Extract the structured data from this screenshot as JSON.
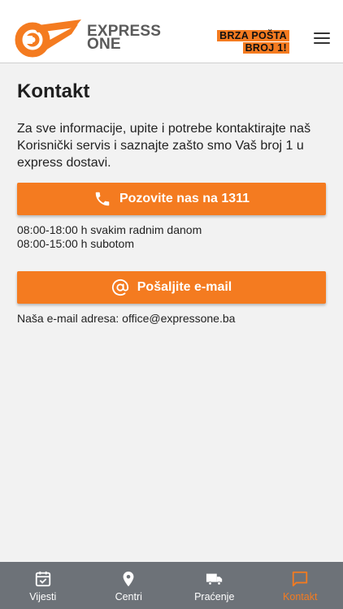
{
  "header": {
    "brand_line1": "EXPRESS",
    "brand_line2": "ONE",
    "tagline_line1": "BRZA POŠTA",
    "tagline_line2": "BROJ 1!",
    "menu_icon": "hamburger-menu-icon"
  },
  "main": {
    "title": "Kontakt",
    "intro": "Za sve informacije, upite i potrebe kontaktirajte naš Korisnički servis i saznajte zašto smo Vaš broj 1 u express dostavi.",
    "call_button": "Pozovite nas na 1311",
    "hours_weekdays": "08:00-18:00 h svakim radnim danom",
    "hours_saturday": "08:00-15:00 h subotom",
    "email_button": "Pošaljite e-mail",
    "email_address_text": "Naša e-mail adresa: office@expressone.ba"
  },
  "bottom_nav": {
    "items": [
      {
        "label": "Vijesti",
        "icon": "calendar-check-icon"
      },
      {
        "label": "Centri",
        "icon": "map-pin-icon"
      },
      {
        "label": "Praćenje",
        "icon": "truck-icon"
      },
      {
        "label": "Kontakt",
        "icon": "chat-icon"
      }
    ],
    "active": "Kontakt"
  },
  "colors": {
    "accent": "#f47b20",
    "nav_background": "#6d7278",
    "brand_gray": "#5a5a5a"
  }
}
